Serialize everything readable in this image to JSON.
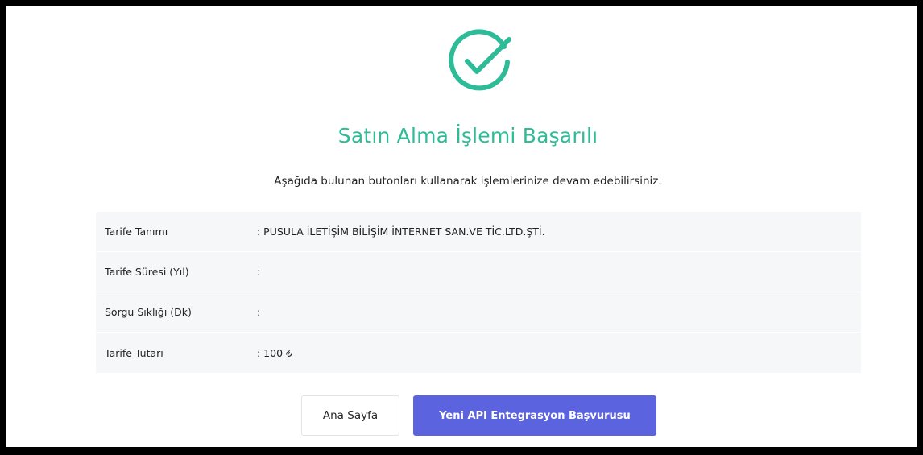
{
  "page": {
    "title": "Satın Alma İşlemi Başarılı",
    "subtitle": "Aşağıda bulunan butonları kullanarak işlemlerinize devam edebilirsiniz."
  },
  "details": [
    {
      "label": "Tarife Tanımı",
      "value": ": PUSULA İLETİŞİM BİLİŞİM İNTERNET SAN.VE TİC.LTD.ŞTİ."
    },
    {
      "label": "Tarife Süresi (Yıl)",
      "value": ":"
    },
    {
      "label": "Sorgu Sıklığı (Dk)",
      "value": ":"
    },
    {
      "label": "Tarife Tutarı",
      "value": ": 100 ₺"
    }
  ],
  "buttons": {
    "home_label": "Ana Sayfa",
    "new_application_label": "Yeni API Entegrasyon Başvurusu"
  },
  "icons": {
    "success": "check-circle-icon"
  },
  "colors": {
    "success": "#2ebc98",
    "primary": "#5b63de",
    "panel": "#f6f7f9"
  }
}
